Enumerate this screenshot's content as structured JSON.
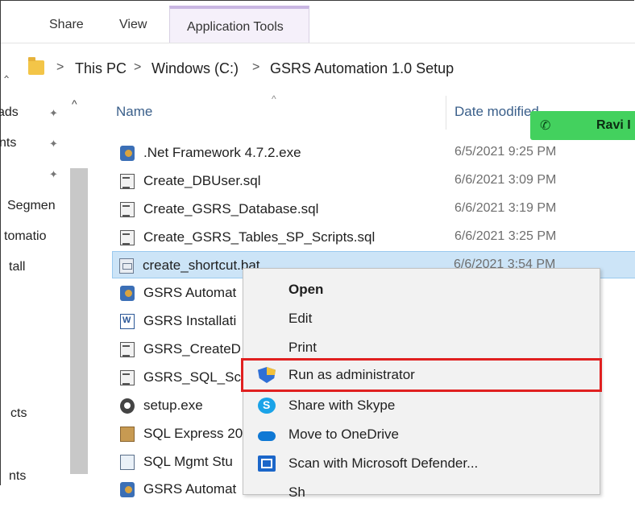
{
  "ribbon": {
    "tabs": [
      {
        "label": "Share"
      },
      {
        "label": "View"
      },
      {
        "label": "Application Tools"
      }
    ]
  },
  "address": {
    "crumbs": [
      "This PC",
      "Windows (C:)",
      "GSRS Automation 1.0 Setup"
    ]
  },
  "nav": {
    "items": [
      "ads",
      "nts",
      "Segmen",
      "tomatio",
      "tall",
      "cts",
      "nts"
    ]
  },
  "columns": {
    "name": "Name",
    "date": "Date modified"
  },
  "call": {
    "name": "Ravi I"
  },
  "files": [
    {
      "name": ".Net Framework 4.7.2.exe",
      "date": "6/5/2021 9:25 PM",
      "icon": "exe-icon"
    },
    {
      "name": "Create_DBUser.sql",
      "date": "6/6/2021 3:09 PM",
      "icon": "sql-file-icon"
    },
    {
      "name": "Create_GSRS_Database.sql",
      "date": "6/6/2021 3:19 PM",
      "icon": "sql-file-icon"
    },
    {
      "name": "Create_GSRS_Tables_SP_Scripts.sql",
      "date": "6/6/2021 3:25 PM",
      "icon": "sql-file-icon"
    },
    {
      "name": "create_shortcut.bat",
      "date": "6/6/2021 3:54 PM",
      "icon": "bat-file-icon"
    },
    {
      "name": "GSRS Automat",
      "date": "",
      "icon": "exe-icon"
    },
    {
      "name": "GSRS Installati",
      "date": "",
      "icon": "word-doc-icon"
    },
    {
      "name": "GSRS_CreateD",
      "date": "",
      "icon": "sql-file-icon"
    },
    {
      "name": "GSRS_SQL_Scr",
      "date": "",
      "icon": "sql-file-icon"
    },
    {
      "name": "setup.exe",
      "date": "",
      "icon": "gear-icon"
    },
    {
      "name": "SQL Express 20",
      "date": "",
      "icon": "box-icon"
    },
    {
      "name": "SQL Mgmt Stu",
      "date": "",
      "icon": "installer-icon"
    },
    {
      "name": "GSRS Automat",
      "date": "",
      "icon": "exe-icon"
    }
  ],
  "context_menu": {
    "items": [
      {
        "label": "Open",
        "icon": ""
      },
      {
        "label": "Edit",
        "icon": ""
      },
      {
        "label": "Print",
        "icon": ""
      },
      {
        "label": "Run as administrator",
        "icon": "uac-shield-icon"
      },
      {
        "label": "Share with Skype",
        "icon": "skype-icon"
      },
      {
        "label": "Move to OneDrive",
        "icon": "onedrive-cloud-icon"
      },
      {
        "label": "Scan with Microsoft Defender...",
        "icon": "defender-icon"
      },
      {
        "label": "Sh",
        "icon": "share-icon"
      }
    ]
  },
  "colors": {
    "selection": "#cce4f7",
    "highlight_box": "#e02020",
    "call_banner": "#43d15e",
    "app_tools_accent": "#c9b6e2"
  }
}
